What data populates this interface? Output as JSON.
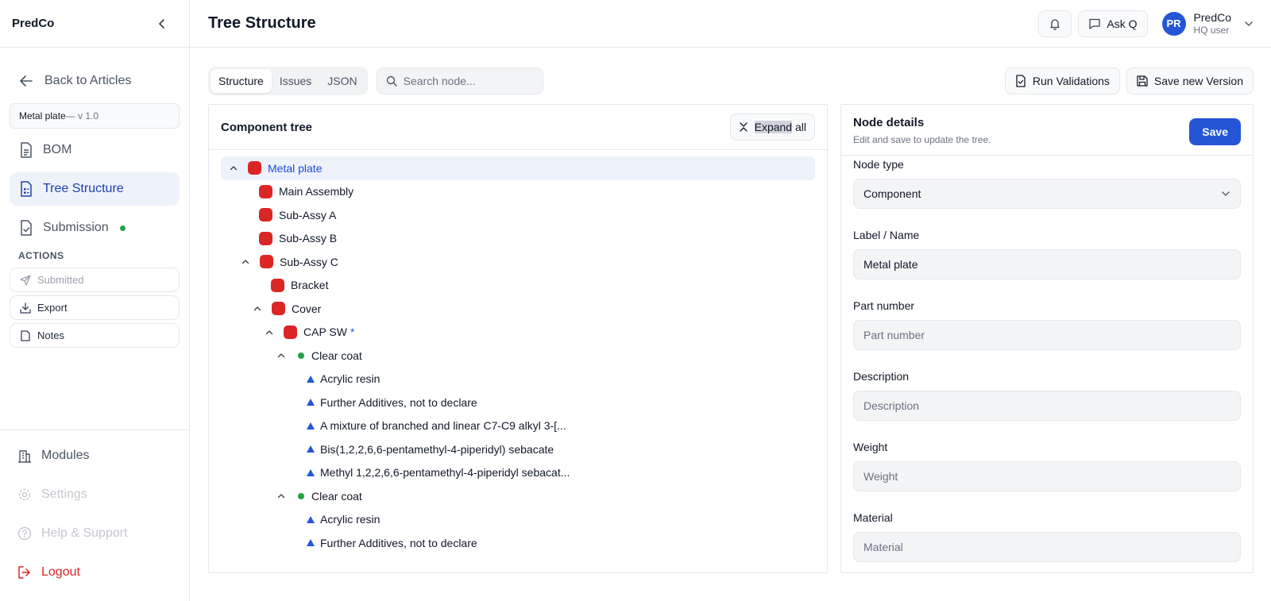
{
  "sidebar": {
    "brand": "PredCo",
    "back_label": "Back to Articles",
    "article": {
      "name": "Metal plate",
      "version": " — v 1.0"
    },
    "nav": [
      {
        "label": "BOM",
        "icon": "document-icon"
      },
      {
        "label": "Tree Structure",
        "icon": "tree-list-icon"
      },
      {
        "label": "Submission",
        "icon": "file-check-icon"
      }
    ],
    "actions_label": "ACTIONS",
    "actions": [
      {
        "label": "Submitted",
        "icon": "send-icon"
      },
      {
        "label": "Export",
        "icon": "download-icon"
      },
      {
        "label": "Notes",
        "icon": "note-icon"
      }
    ],
    "bottom": [
      {
        "label": "Modules",
        "icon": "building-icon"
      },
      {
        "label": "Settings",
        "icon": "gear-icon"
      },
      {
        "label": "Help & Support",
        "icon": "help-icon"
      },
      {
        "label": "Logout",
        "icon": "logout-icon"
      }
    ],
    "colors": {
      "active_bg": "#eef2fb",
      "active_text": "#1e40af",
      "status_dot": "#22a447",
      "logout": "#dc2626"
    }
  },
  "header": {
    "title": "Tree Structure",
    "ask_label": "Ask Q",
    "user": {
      "initials": "PR",
      "name": "PredCo",
      "role": "HQ user"
    }
  },
  "toolbar": {
    "tabs": [
      "Structure",
      "Issues",
      "JSON"
    ],
    "search_placeholder": "Search node...",
    "run_validations": "Run Validations",
    "save_version": "Save new Version"
  },
  "tree": {
    "title": "Component tree",
    "expand_label_pre": "",
    "expand_label_hl": "Expand",
    "expand_label_post": " all",
    "nodes": [
      {
        "label": "Metal plate"
      },
      {
        "label": "Main Assembly"
      },
      {
        "label": "Sub-Assy A"
      },
      {
        "label": "Sub-Assy B"
      },
      {
        "label": "Sub-Assy C"
      },
      {
        "label": "Bracket"
      },
      {
        "label": "Cover"
      },
      {
        "label": "CAP SW",
        "marker": "*"
      },
      {
        "label": "Clear coat"
      },
      {
        "label": "Acrylic resin"
      },
      {
        "label": "Further Additives, not to declare"
      },
      {
        "label": "A mixture of branched and linear C7-C9 alkyl 3-[..."
      },
      {
        "label": "Bis(1,2,2,6,6-pentamethyl-4-piperidyl) sebacate"
      },
      {
        "label": "Methyl 1,2,2,6,6-pentamethyl-4-piperidyl sebacat..."
      },
      {
        "label": "Clear coat"
      },
      {
        "label": "Acrylic resin"
      },
      {
        "label": "Further Additives, not to declare"
      }
    ],
    "colors": {
      "component": "#dc2626",
      "coating": "#22a447",
      "substance": "#2456d6",
      "selected_bg": "#eef2fb"
    }
  },
  "details": {
    "title": "Node details",
    "subtitle": "Edit and save to update the tree.",
    "save_label": "Save",
    "fields": {
      "node_type": {
        "label": "Node type",
        "value": "Component"
      },
      "label_name": {
        "label": "Label / Name",
        "value": "Metal plate"
      },
      "part_number": {
        "label": "Part number",
        "placeholder": "Part number"
      },
      "description": {
        "label": "Description",
        "placeholder": "Description"
      },
      "weight": {
        "label": "Weight",
        "placeholder": "Weight"
      },
      "material": {
        "label": "Material",
        "placeholder": "Material"
      }
    },
    "colors": {
      "primary": "#2456d6"
    }
  }
}
